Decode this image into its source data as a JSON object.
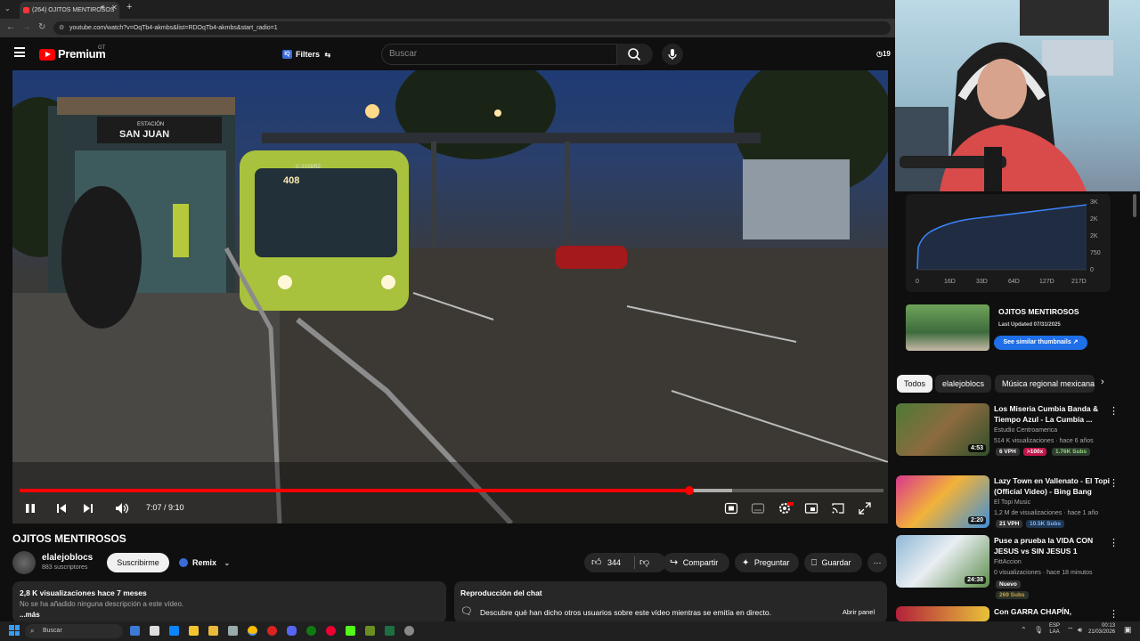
{
  "browser": {
    "tab_title": "(264) OJITOS MENTIROSOS",
    "new_tab": "+",
    "url": "youtube.com/watch?v=OqTb4-akmbs&list=RDOqTb4-akmbs&start_radio=1"
  },
  "header": {
    "logo_text": "Premium",
    "logo_region": "GT",
    "filters_label": "Filters",
    "filters_badge": "IQ",
    "search_placeholder": "Buscar",
    "clock_glyph": "19"
  },
  "video": {
    "sign_station": "ESTACIÓN",
    "sign_name": "SAN JUAN",
    "bus_code": "C-315BRZ",
    "bus_route": "408",
    "progress_fraction": 0.775,
    "buffered_fraction": 0.825,
    "time_display": "7:07 / 9:10"
  },
  "details": {
    "title": "OJITOS MENTIROSOS",
    "channel_name": "elalejoblocs",
    "subscribers": "883 suscriptores",
    "subscribe_label": "Suscribirme",
    "remix_label": "Remix",
    "like_count": "344",
    "share_label": "Compartir",
    "ask_label": "Preguntar",
    "save_label": "Guardar",
    "more_label": "⋯"
  },
  "description": {
    "stats": "2,8 K visualizaciones  hace 7 meses",
    "text": "No se ha añadido ninguna descripción a este vídeo.",
    "more": "...más"
  },
  "chat_replay": {
    "title": "Reproducción del chat",
    "body": "Descubre qué han dicho otros usuarios sobre este vídeo mientras se emitía en directo.",
    "open_label": "Abrir panel"
  },
  "stats_chart": {
    "y_ticks": [
      "3K",
      "2K",
      "2K",
      "750",
      "0"
    ],
    "x_ticks": [
      "0",
      "16D",
      "33D",
      "64D",
      "127D",
      "217D"
    ]
  },
  "video_card": {
    "title": "OJITOS MENTIROSOS",
    "updated": "Last Updated 07/31/2025",
    "button": "See similar thumbnails ↗"
  },
  "chips": [
    "Todos",
    "elalejoblocs",
    "Música regional mexicana"
  ],
  "recommendations": [
    {
      "title": "Los Miseria Cumbia Banda & Tiempo Azul - La Cumbia ...",
      "channel": "Estudio Centroamerica",
      "meta": "514 K visualizaciones · hace 6 años",
      "vph": "6 VPH",
      "outlier": ">100x",
      "subs": "1.76K Subs",
      "duration": "4:53"
    },
    {
      "title": "Lazy Town en Vallenato - El Topi (Official Video) - Bing Bang",
      "channel": "El Topi Music",
      "meta": "1,2 M de visualizaciones · hace 1 año",
      "vph": "21 VPH",
      "outlier": "",
      "subs": "10.5K Subs",
      "duration": "2:20"
    },
    {
      "title": "Puse a prueba la VIDA CON JESUS vs SIN JESUS 1",
      "channel": "FittAccion",
      "meta": "0 visualizaciones · hace 18 minutos",
      "vph": "Nuevo",
      "outlier": "",
      "subs": "269 Subs",
      "duration": "24:38"
    },
    {
      "title": "Con GARRA CHAPÍN,",
      "channel": "",
      "meta": "",
      "vph": "",
      "outlier": "",
      "subs": "",
      "duration": ""
    }
  ],
  "taskbar": {
    "search_label": "Buscar",
    "lang": "ESP",
    "lang2": "LAA",
    "time": "00:13",
    "date": "21/03/2026"
  },
  "colors": {
    "accent_red": "#ff0000",
    "accent_blue": "#3a6bd8",
    "chart_line": "#3b82f6"
  }
}
